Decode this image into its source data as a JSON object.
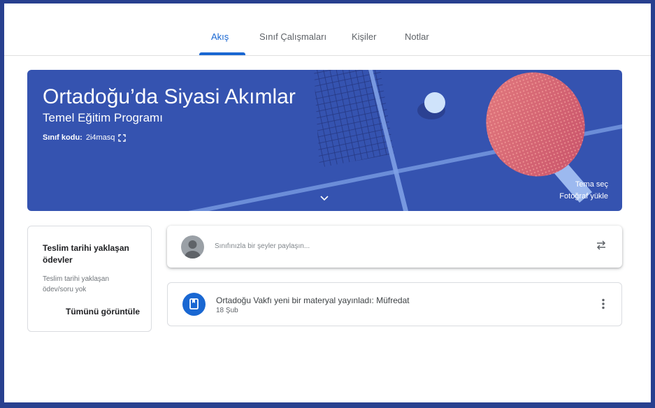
{
  "tabs": [
    {
      "label": "Akış",
      "active": true
    },
    {
      "label": "Sınıf Çalışmaları",
      "active": false
    },
    {
      "label": "Kişiler",
      "active": false
    },
    {
      "label": "Notlar",
      "active": false
    }
  ],
  "banner": {
    "title": "Ortadoğu’da Siyasi Akımlar",
    "subtitle": "Temel Eğitim Programı",
    "class_code_label": "Sınıf kodu:",
    "class_code": "2i4masq",
    "select_theme": "Tema seç",
    "upload_photo": "Fotoğraf yükle",
    "color": "#3553b0",
    "icons": [
      "fullscreen-icon",
      "chevron-down-icon"
    ]
  },
  "upcoming": {
    "title": "Teslim tarihi yaklaşan ödevler",
    "empty_text": "Teslim tarihi yaklaşan ödev/soru yok",
    "view_all": "Tümünü görüntüle"
  },
  "share": {
    "placeholder": "Sınıfınızla bir şeyler paylaşın...",
    "icons": [
      "avatar",
      "repost-icon"
    ]
  },
  "post": {
    "title": "Ortadoğu Vakfı yeni bir materyal yayınladı: Müfredat",
    "date": "18 Şub",
    "icons": [
      "material-icon",
      "more-vert-icon"
    ]
  },
  "colors": {
    "accent": "#1967d2",
    "frame": "#28408f"
  }
}
